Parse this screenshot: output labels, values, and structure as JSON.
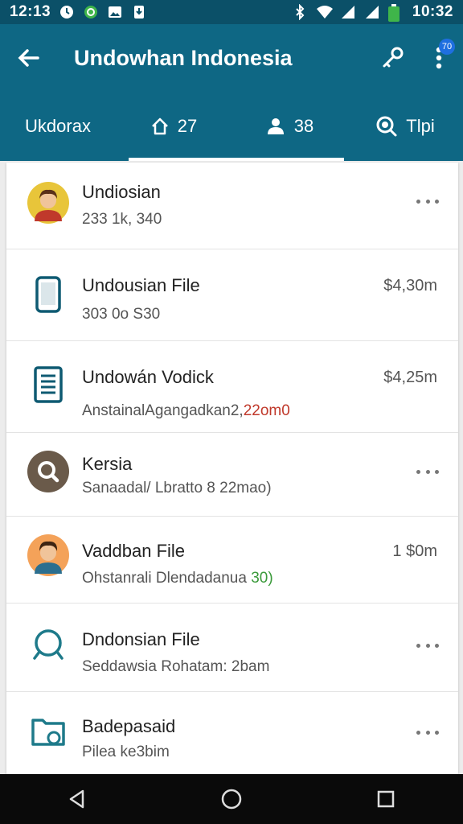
{
  "status_bar": {
    "time_left": "12:13",
    "time_right": "10:32",
    "bg_color": "#0b5068"
  },
  "app_bar": {
    "title": "Undowhan Indonesia",
    "badge": "70",
    "bg_color": "#0e6784"
  },
  "tabs": [
    {
      "label": "Ukdorax",
      "icon": null
    },
    {
      "label": "27",
      "icon": "home-icon"
    },
    {
      "label": "38",
      "icon": "people-icon"
    },
    {
      "label": "Tlpi",
      "icon": "search-icon"
    }
  ],
  "rows": [
    {
      "title": "Undiosian",
      "subtitle": "233 1k, 340",
      "meta": "",
      "icon": "avatar-man-icon",
      "has_more": true
    },
    {
      "title": "Undousian File",
      "subtitle": "303 0o S30",
      "meta": "$4,30m",
      "icon": "phone-icon",
      "has_more": false
    },
    {
      "title": "Undowán Vodick",
      "subtitle_main": "AnstainalAgangadkan2,",
      "subtitle_accent": "22om0",
      "meta": "$4,25m",
      "icon": "document-icon",
      "has_more": false
    },
    {
      "title": "Kersia",
      "subtitle": "Sanaadal/ Lbratto 8 22mao)",
      "meta": "",
      "icon": "search-circle-icon",
      "has_more": true
    },
    {
      "title": "Vaddban File",
      "subtitle_main": "Ohstanrali Dlendadanua",
      "subtitle_accent": "30)",
      "meta": "1 $0m",
      "icon": "avatar-boy-icon",
      "has_more": false
    },
    {
      "title": "Dndonsian File",
      "subtitle": "Seddawsia Rohatam: 2bam",
      "meta": "",
      "icon": "search-outline-icon",
      "has_more": true
    },
    {
      "title": "Badepasaid",
      "subtitle": "Pilea ke3bim",
      "meta": "",
      "icon": "folder-icon",
      "has_more": true
    }
  ]
}
